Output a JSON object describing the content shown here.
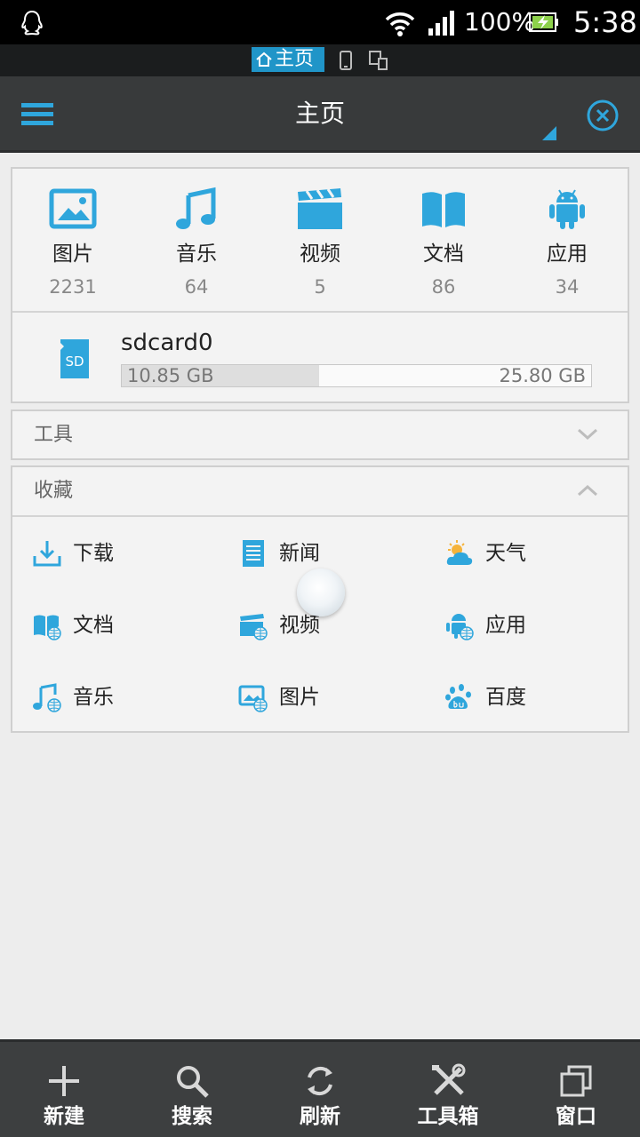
{
  "status_bar": {
    "battery": "100%",
    "time": "5:38"
  },
  "window_switcher": {
    "active_tab": "主页"
  },
  "header": {
    "title": "主页"
  },
  "categories": [
    {
      "label": "图片",
      "count": "2231",
      "icon": "image-icon"
    },
    {
      "label": "音乐",
      "count": "64",
      "icon": "music-icon"
    },
    {
      "label": "视频",
      "count": "5",
      "icon": "video-icon"
    },
    {
      "label": "文档",
      "count": "86",
      "icon": "book-icon"
    },
    {
      "label": "应用",
      "count": "34",
      "icon": "android-icon"
    }
  ],
  "storage": {
    "name": "sdcard0",
    "used": "10.85 GB",
    "total": "25.80 GB",
    "used_fraction": 0.42,
    "icon_text": "SD"
  },
  "tools_section": {
    "title": "工具"
  },
  "favorites": {
    "title": "收藏",
    "items": [
      {
        "label": "下载",
        "icon": "download-icon"
      },
      {
        "label": "新闻",
        "icon": "news-icon"
      },
      {
        "label": "天气",
        "icon": "weather-icon"
      },
      {
        "label": "文档",
        "icon": "book-web-icon"
      },
      {
        "label": "视频",
        "icon": "video-web-icon"
      },
      {
        "label": "应用",
        "icon": "android-web-icon"
      },
      {
        "label": "音乐",
        "icon": "music-web-icon"
      },
      {
        "label": "图片",
        "icon": "image-web-icon"
      },
      {
        "label": "百度",
        "icon": "baidu-icon"
      }
    ]
  },
  "bottom_bar": {
    "new_label": "新建",
    "search_label": "搜索",
    "refresh_label": "刷新",
    "toolbox_label": "工具箱",
    "window_label": "窗口"
  },
  "colors": {
    "accent": "#2fa6dc",
    "header": "#383a3b",
    "bottom_bar": "#3d3f40"
  }
}
